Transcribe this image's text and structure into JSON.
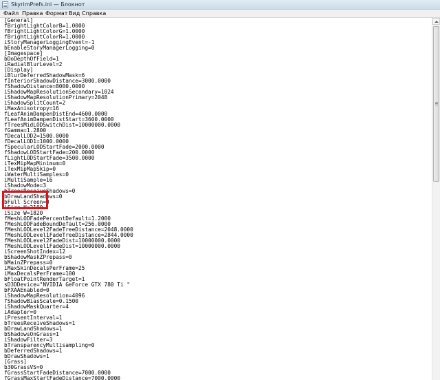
{
  "window": {
    "title": "SkyrimPrefs.ini — Блокнот"
  },
  "menu": {
    "items": [
      "Файл",
      "Правка",
      "Формат",
      "Вид",
      "Справка"
    ]
  },
  "editor": {
    "lines": [
      "[General]",
      "fBrightLightColorB=1.0000",
      "fBrightLightColorG=1.0000",
      "fBrightLightColorR=1.0000",
      "iStoryManagerLoggingEvent=-1",
      "bEnableStoryManagerLogging=0",
      "[Imagespace]",
      "bDoDepthOfField=1",
      "iRadialBlurLevel=2",
      "[Display]",
      "iBlurDeferredShadowMask=6",
      "fInteriorShadowDistance=3000.0000",
      "fShadowDistance=8000.0000",
      "iShadowMapResolutionSecondary=1024",
      "iShadowMapResolutionPrimary=2048",
      "iShadowSplitCount=2",
      "iMaxAnisotropy=16",
      "fLeafAnimDampenDistEnd=4600.0000",
      "fLeafAnimDampenDistStart=3600.0000",
      "fTreesMidLODSwitchDist=10000000.0000",
      "fGamma=1.2800",
      "fDecalLOD2=1500.0000",
      "fDecalLOD1=1000.0000",
      "fSpecularLODStartFade=2000.0000",
      "fShadowLODStartFade=200.0000",
      "fLightLODStartFade=3500.0000",
      "iTexMipMapMinimum=0",
      "iTexMipMapSkip=0",
      "iWaterMultiSamples=0",
      "iMultiSample=16",
      "iShadowMode=3",
      "bTreesReceiveShadows=0",
      "bDrawLandShadows=0",
      "bFull Screen=0",
      "iSize H=2100",
      "iSize W=1820",
      "fMeshLODFadePercentDefault=1.2000",
      "fMeshLODFadeBoundDefault=256.0000",
      "fMeshLODLevel2FadeTreeDistance=2048.0000",
      "fMeshLODLevel1FadeTreeDistance=2844.0000",
      "fMeshLODLevel2FadeDist=10000000.0000",
      "fMeshLODLevel1FadeDist=10000000.0000",
      "iScreenShotIndex=12",
      "bShadowMaskZPrepass=0",
      "bMainZPrepass=0",
      "iMaxSkinDecalsPerFrame=25",
      "iMaxDecalsPerFrame=100",
      "bFloatPointRenderTarget=1",
      "sD3DDevice=\"NVIDIA GeForce GTX 780 Ti \"",
      "bFXAAEnabled=0",
      "iShadowMapResolution=4096",
      "fShadowBiasScale=0.1500",
      "iShadowMaskQuarter=4",
      "iAdapter=0",
      "iPresentInterval=1",
      "bTreesReceiveShadows=1",
      "bDrawLandShadows=1",
      "bShadowsOnGrass=1",
      "iShadowFilter=3",
      "bTransparencyMultisampling=0",
      "bDeferredShadows=1",
      "bDrawShadows=1",
      "[Grass]",
      "b30GrassVS=0",
      "fGrassStartFadeDistance=7000.0000",
      "fGrassMaxStartFadeDistance=7000.0000",
      "fGrassMinStartFadeDistance=0.0000",
      "[MAIN]"
    ]
  },
  "highlight": {
    "color": "#d4161f",
    "note": "red box around display resolution settings"
  },
  "icons": {
    "app": "notepad-icon",
    "scroll_up": "scroll-up-arrow-icon"
  }
}
